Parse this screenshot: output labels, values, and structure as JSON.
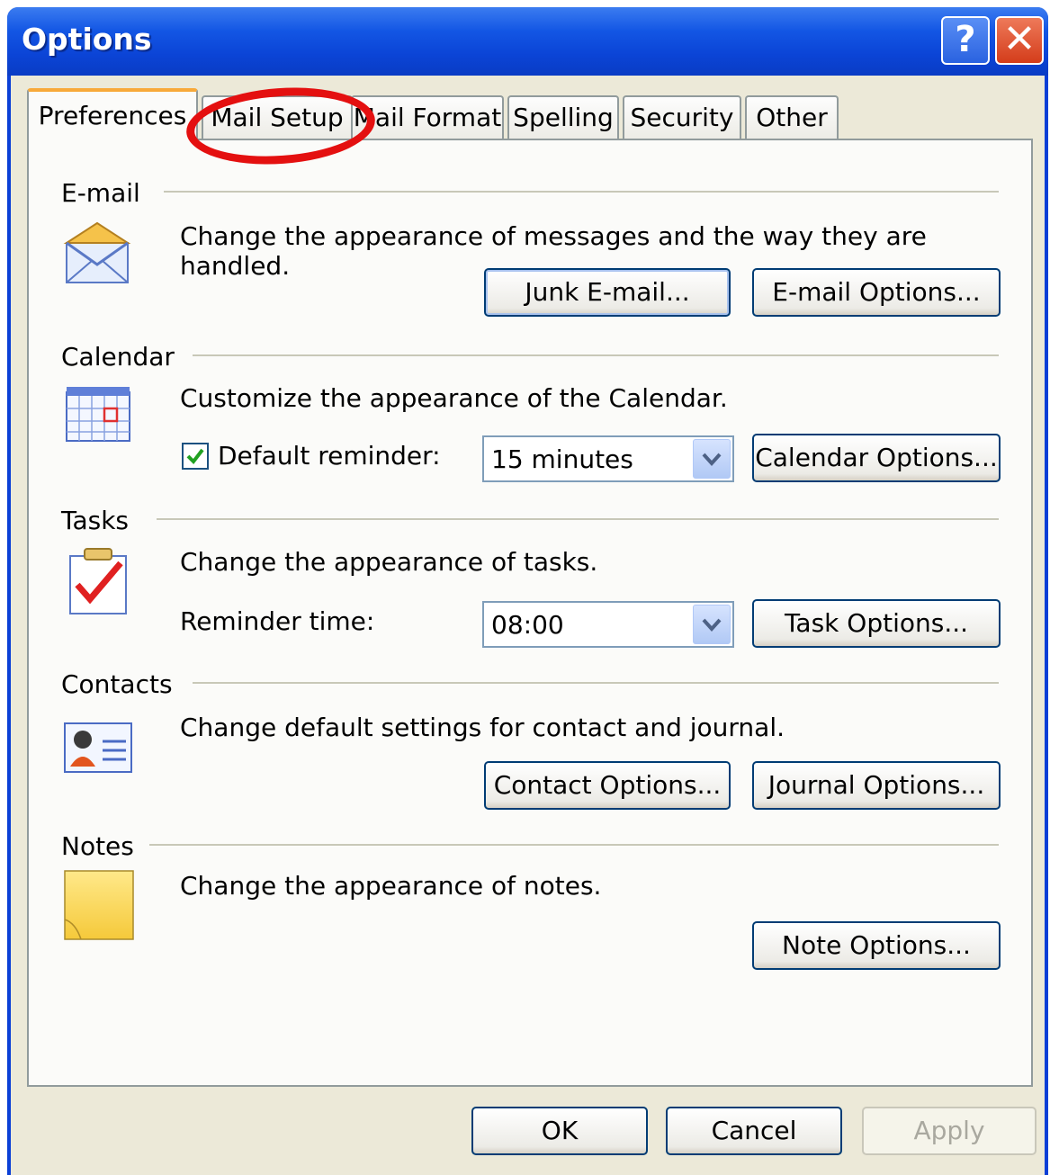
{
  "window": {
    "title": "Options"
  },
  "titlebar_buttons": {
    "help": "?",
    "close": "✕"
  },
  "tabs": [
    "Preferences",
    "Mail Setup",
    "Mail Format",
    "Spelling",
    "Security",
    "Other"
  ],
  "active_tab": "Preferences",
  "email": {
    "heading": "E-mail",
    "description": "Change the appearance of messages and the way they are handled.",
    "junk_button": "Junk E-mail...",
    "options_button": "E-mail Options..."
  },
  "calendar": {
    "heading": "Calendar",
    "description": "Customize the appearance of the Calendar.",
    "reminder_label": "Default reminder:",
    "reminder_checked": true,
    "reminder_value": "15 minutes",
    "options_button": "Calendar Options..."
  },
  "tasks": {
    "heading": "Tasks",
    "description": "Change the appearance of tasks.",
    "reminder_time_label": "Reminder time:",
    "reminder_time_value": "08:00",
    "options_button": "Task Options..."
  },
  "contacts": {
    "heading": "Contacts",
    "description": "Change default settings for contact and journal.",
    "contact_button": "Contact Options...",
    "journal_button": "Journal Options..."
  },
  "notes": {
    "heading": "Notes",
    "description": "Change the appearance of notes.",
    "options_button": "Note Options..."
  },
  "footer": {
    "ok": "OK",
    "cancel": "Cancel",
    "apply": "Apply"
  },
  "colors": {
    "title_bar": "#0a3fd6",
    "annotation": "#e41010",
    "active_tab_accent": "#f8a93a"
  }
}
